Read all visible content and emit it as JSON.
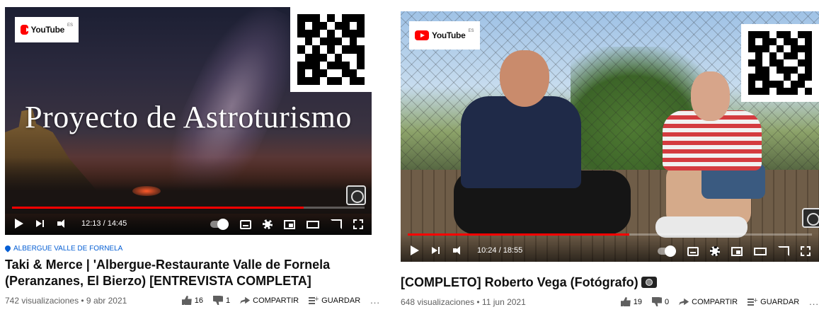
{
  "cards": [
    {
      "player": {
        "brand": "YouTube",
        "brand_region": "ES",
        "overlay_title": "Proyecto de Astroturismo",
        "time": "12:13 / 14:45",
        "progress_fraction": 0.828
      },
      "channel": "ALBERGUE VALLE DE FORNELA",
      "title": "Taki & Merce | 'Albergue-Restaurante Valle de Fornela (Peranzanes, El Bierzo) [ENTREVISTA COMPLETA]",
      "views": "742 visualizaciones • 9 abr 2021",
      "likes": "16",
      "dislikes": "1",
      "share_label": "COMPARTIR",
      "save_label": "GUARDAR",
      "more": "..."
    },
    {
      "player": {
        "brand": "YouTube",
        "brand_region": "ES",
        "time": "10:24 / 18:55",
        "progress_fraction": 0.549
      },
      "title": "[COMPLETO] Roberto Vega (Fotógrafo)",
      "views": "648 visualizaciones • 11 jun 2021",
      "likes": "19",
      "dislikes": "0",
      "share_label": "COMPARTIR",
      "save_label": "GUARDAR",
      "more": "..."
    }
  ],
  "colors": {
    "progress": "#ff0000",
    "channel_link": "#065fd4",
    "meta_text": "#606060"
  },
  "icons": [
    "play-icon",
    "next-icon",
    "volume-icon",
    "autoplay-icon",
    "subtitles-icon",
    "settings-icon",
    "miniplayer-icon",
    "theater-icon",
    "cast-icon",
    "fullscreen-icon",
    "like-icon",
    "dislike-icon",
    "share-icon",
    "save-icon",
    "location-pin-icon",
    "camera-icon",
    "qr-code"
  ]
}
